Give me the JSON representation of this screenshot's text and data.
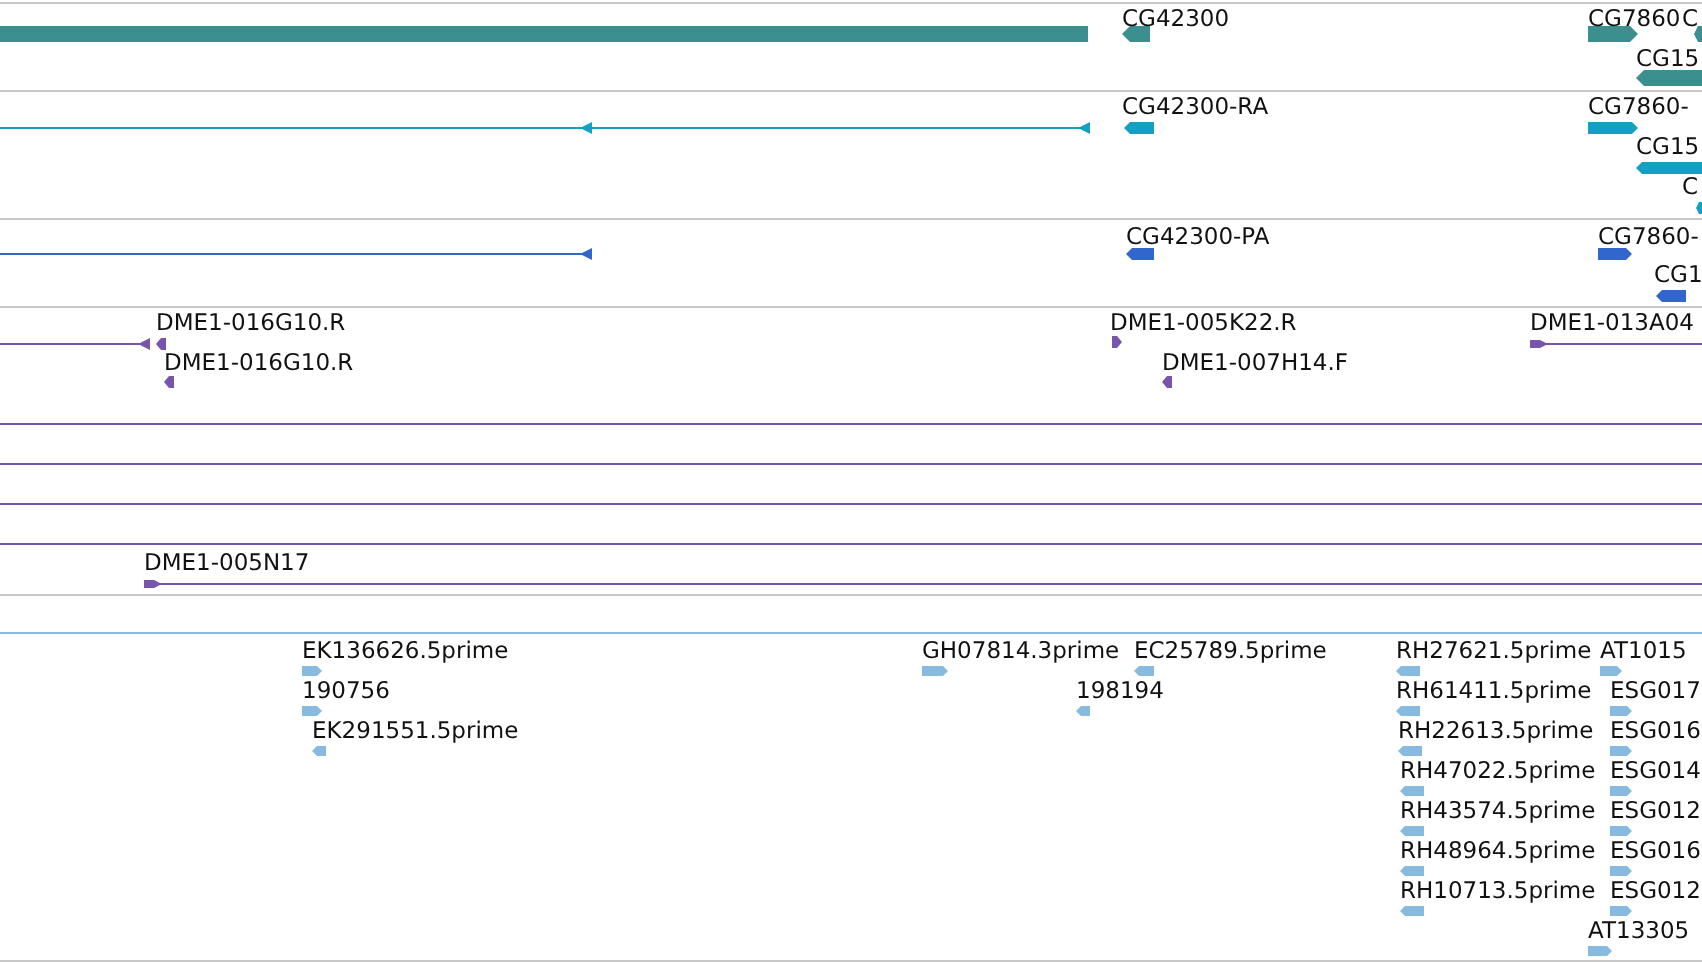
{
  "tracks": [
    {
      "kind": "gene",
      "color": "#3b8f8f",
      "features": [
        {
          "kind": "block",
          "arrow": false
        },
        {
          "kind": "block",
          "arrow": true,
          "reverse": true,
          "label": "CG42300"
        },
        {
          "kind": "block",
          "arrow": true,
          "reverse": false,
          "label": "CG7860"
        },
        {
          "kind": "block",
          "arrow": true,
          "reverse": true,
          "label": "C"
        },
        {
          "kind": "block",
          "arrow": true,
          "reverse": true,
          "label": "CG15"
        }
      ]
    },
    {
      "kind": "transcript",
      "color": "#13a0c2",
      "features": [
        {
          "kind": "line",
          "arrow": true,
          "reverse": true
        },
        {
          "kind": "line",
          "arrow": true,
          "reverse": true
        },
        {
          "kind": "block",
          "arrow": true,
          "reverse": true,
          "label": "CG42300-RA"
        },
        {
          "kind": "block",
          "arrow": true,
          "reverse": false,
          "label": "CG7860-"
        },
        {
          "kind": "block",
          "arrow": true,
          "reverse": true,
          "label": "CG15"
        },
        {
          "kind": "block",
          "arrow": true,
          "reverse": true,
          "label": "C"
        }
      ]
    },
    {
      "kind": "cds",
      "color": "#3366cc",
      "features": [
        {
          "kind": "line",
          "arrow": true,
          "reverse": true
        },
        {
          "kind": "block",
          "arrow": true,
          "reverse": true,
          "label": "CG42300-PA"
        },
        {
          "kind": "block",
          "arrow": true,
          "reverse": false,
          "label": "CG7860-"
        },
        {
          "kind": "block",
          "arrow": true,
          "reverse": true,
          "label": "CG1"
        }
      ]
    },
    {
      "kind": "clone",
      "color": "#7755aa",
      "features": [
        {
          "kind": "line",
          "arrow": true,
          "reverse": true
        },
        {
          "kind": "block",
          "arrow": true,
          "reverse": true,
          "label": "DME1-016G10.R"
        },
        {
          "kind": "block",
          "arrow": true,
          "reverse": true,
          "label": "DME1-016G10.R"
        },
        {
          "kind": "block",
          "arrow": true,
          "reverse": false,
          "label": "DME1-005K22.R"
        },
        {
          "kind": "block",
          "arrow": true,
          "reverse": true,
          "label": "DME1-007H14.F"
        },
        {
          "kind": "line",
          "arrow": true,
          "reverse": false,
          "label": "DME1-013A04"
        },
        {
          "kind": "line",
          "arrow": false
        },
        {
          "kind": "line",
          "arrow": false
        },
        {
          "kind": "line",
          "arrow": false
        },
        {
          "kind": "line",
          "arrow": false
        },
        {
          "kind": "line",
          "arrow": true,
          "reverse": false,
          "label": "DME1-005N17"
        }
      ]
    },
    {
      "kind": "est",
      "color": "#86bbdf",
      "features": [
        {
          "kind": "block",
          "arrow": true,
          "reverse": false,
          "label": "EK136626.5prime"
        },
        {
          "kind": "block",
          "arrow": true,
          "reverse": false,
          "label": "190756"
        },
        {
          "kind": "block",
          "arrow": true,
          "reverse": true,
          "label": "EK291551.5prime"
        },
        {
          "kind": "block",
          "arrow": true,
          "reverse": false,
          "label": "GH07814.3prime"
        },
        {
          "kind": "block",
          "arrow": true,
          "reverse": true,
          "label": "EC25789.5prime"
        },
        {
          "kind": "block",
          "arrow": true,
          "reverse": true,
          "label": "198194"
        },
        {
          "kind": "block",
          "arrow": true,
          "reverse": true,
          "label": "RH27621.5prime"
        },
        {
          "kind": "block",
          "arrow": true,
          "reverse": true,
          "label": "RH61411.5prime"
        },
        {
          "kind": "block",
          "arrow": true,
          "reverse": true,
          "label": "RH22613.5prime"
        },
        {
          "kind": "block",
          "arrow": true,
          "reverse": true,
          "label": "RH47022.5prime"
        },
        {
          "kind": "block",
          "arrow": true,
          "reverse": true,
          "label": "RH43574.5prime"
        },
        {
          "kind": "block",
          "arrow": true,
          "reverse": true,
          "label": "RH48964.5prime"
        },
        {
          "kind": "block",
          "arrow": true,
          "reverse": true,
          "label": "RH10713.5prime"
        },
        {
          "kind": "block",
          "arrow": true,
          "reverse": false,
          "label": "AT1015"
        },
        {
          "kind": "block",
          "arrow": true,
          "reverse": false,
          "label": "ESG017"
        },
        {
          "kind": "block",
          "arrow": true,
          "reverse": false,
          "label": "ESG016"
        },
        {
          "kind": "block",
          "arrow": true,
          "reverse": false,
          "label": "ESG014"
        },
        {
          "kind": "block",
          "arrow": true,
          "reverse": false,
          "label": "ESG012"
        },
        {
          "kind": "block",
          "arrow": true,
          "reverse": false,
          "label": "ESG016"
        },
        {
          "kind": "block",
          "arrow": true,
          "reverse": false,
          "label": "ESG012"
        },
        {
          "kind": "block",
          "arrow": true,
          "reverse": false,
          "label": "AT13305"
        }
      ]
    }
  ]
}
